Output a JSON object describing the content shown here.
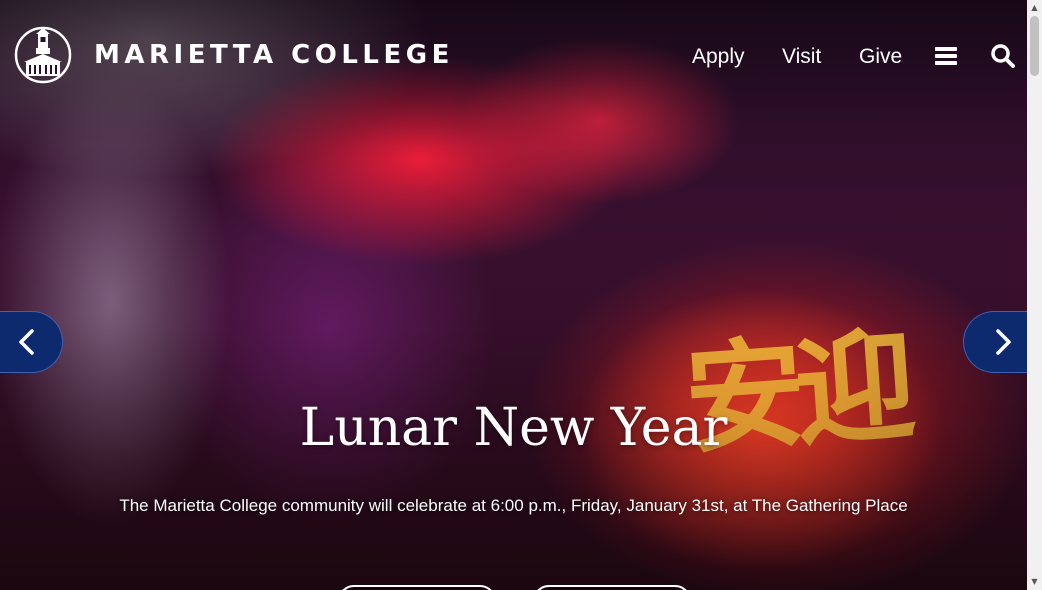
{
  "header": {
    "brand": "MARIETTA COLLEGE",
    "nav": [
      {
        "label": "Apply"
      },
      {
        "label": "Visit"
      },
      {
        "label": "Give"
      }
    ],
    "menu_icon": "hamburger-menu-icon",
    "search_icon": "search-icon"
  },
  "hero": {
    "headline": "Lunar New Year",
    "subtext": "The Marietta College community will celebrate at 6:00 p.m., Friday, January 31st, at The Gathering Place",
    "prev_icon": "chevron-left-icon",
    "next_icon": "chevron-right-icon",
    "lantern_glyphs": "安迎"
  },
  "colors": {
    "arrow_bg": "#0e2a6e",
    "text": "#ffffff"
  }
}
